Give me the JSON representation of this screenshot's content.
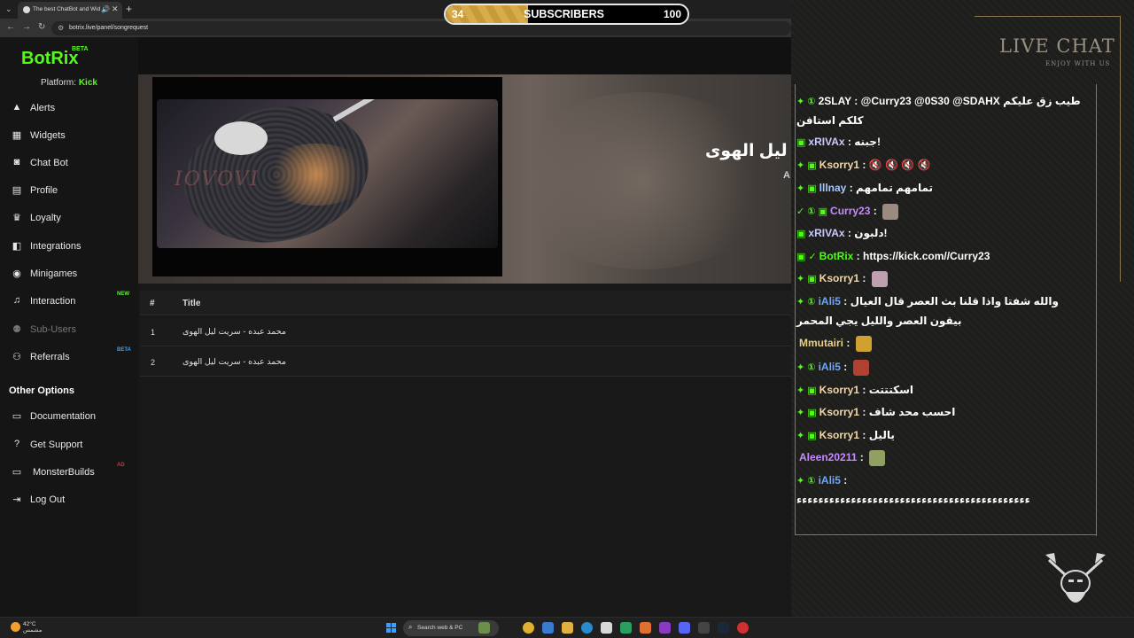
{
  "browser": {
    "tab_title": "The best ChatBot and Widg",
    "url": "botrix.live/panel/songrequest"
  },
  "app": {
    "logo": "BotRix",
    "logo_badge": "BETA",
    "platform_label": "Platform:",
    "platform_value": "Kick",
    "menu": [
      {
        "label": "Alerts",
        "icon": "bell-icon"
      },
      {
        "label": "Widgets",
        "icon": "grid-icon"
      },
      {
        "label": "Chat Bot",
        "icon": "robot-icon"
      },
      {
        "label": "Profile",
        "icon": "id-card-icon"
      },
      {
        "label": "Loyalty",
        "icon": "trophy-icon"
      },
      {
        "label": "Integrations",
        "icon": "integrations-icon"
      },
      {
        "label": "Minigames",
        "icon": "gamepad-icon"
      },
      {
        "label": "Interaction",
        "icon": "music-icon",
        "badge": "NEW"
      },
      {
        "label": "Sub-Users",
        "icon": "users-icon"
      },
      {
        "label": "Referrals",
        "icon": "referrals-icon",
        "badge": "BETA"
      }
    ],
    "other_options_title": "Other Options",
    "other_menu": [
      {
        "label": "Documentation",
        "icon": "book-icon"
      },
      {
        "label": "Get Support",
        "icon": "question-icon"
      },
      {
        "label": "MonsterBuilds",
        "icon": "laptop-icon",
        "badge": "AD"
      },
      {
        "label": "Log Out",
        "icon": "logout-icon"
      }
    ],
    "now_playing": {
      "title": "ت ليل الهوى",
      "artist": "A",
      "cover_watermark": "IOVOVI"
    },
    "table": {
      "col_num": "#",
      "col_title": "Title",
      "rows": [
        {
          "num": "1",
          "title": "محمد عبده - سريت ليل الهوى"
        },
        {
          "num": "2",
          "title": "محمد عبده - سريت ليل الهوى"
        }
      ]
    }
  },
  "overlay": {
    "subs_current": "34",
    "subs_label": "SUBSCRIBERS",
    "subs_goal": "100",
    "subs_progress": 0.34,
    "live_chat_title": "LIVE CHAT",
    "live_chat_subtitle": "ENJOY WITH US",
    "colors": {
      "kick_green": "#53fc18",
      "gold": "#c89a3a"
    },
    "messages": [
      {
        "badges": "✦ ①",
        "user": "2SLAY",
        "color": "#ffffff",
        "text": "@Curry23 @0S30 @SDAHX طيب زق عليكم كلكم استافن"
      },
      {
        "badges": "▣",
        "user": "xRIVAx",
        "color": "#c9c9ff",
        "text": "جبنه!"
      },
      {
        "badges": "✦ ▣",
        "user": "Ksorry1",
        "color": "#f2d7a6",
        "text": "🔇 🔇 🔇 🔇"
      },
      {
        "badges": "✦ ▣",
        "user": "lllnay",
        "color": "#a8c8ff",
        "text": "تمامهم تمامهم"
      },
      {
        "badges": "✓ ① ▣",
        "user": "Curry23",
        "color": "#c68cff",
        "text": ""
      },
      {
        "badges": "▣",
        "user": "xRIVAx",
        "color": "#c9c9ff",
        "text": "دلبون!"
      },
      {
        "badges": "▣ ✓",
        "user": "BotRix",
        "color": "#53fc18",
        "text": "https://kick.com//Curry23"
      },
      {
        "badges": "✦ ▣",
        "user": "Ksorry1",
        "color": "#f2d7a6",
        "text": ""
      },
      {
        "badges": "✦ ①",
        "user": "iAli5",
        "color": "#6aa8ff",
        "text": "والله شفتا واذا قلنا بث العصر قال العيال بيقون العصر والليل يجي المحمر"
      },
      {
        "badges": "",
        "user": "Mmutairi",
        "color": "#e8d08a",
        "text": ""
      },
      {
        "badges": "✦ ①",
        "user": "iAli5",
        "color": "#6aa8ff",
        "text": ""
      },
      {
        "badges": "✦ ▣",
        "user": "Ksorry1",
        "color": "#f2d7a6",
        "text": "اسكتتتت"
      },
      {
        "badges": "✦ ▣",
        "user": "Ksorry1",
        "color": "#f2d7a6",
        "text": "احسب محد شاف"
      },
      {
        "badges": "✦ ▣",
        "user": "Ksorry1",
        "color": "#f2d7a6",
        "text": "ياليل"
      },
      {
        "badges": "",
        "user": "Aleen20211",
        "color": "#c68cff",
        "text": ""
      },
      {
        "badges": "✦ ①",
        "user": "iAli5",
        "color": "#6aa8ff",
        "text": "ءءءءءءءءءءءءءءءءءءءءءءءءءءءءءءءءءءءءءءءءءءء"
      }
    ]
  },
  "taskbar": {
    "weather_temp": "42°C",
    "weather_desc": "مشمس",
    "search_placeholder": "Search web & PC"
  }
}
